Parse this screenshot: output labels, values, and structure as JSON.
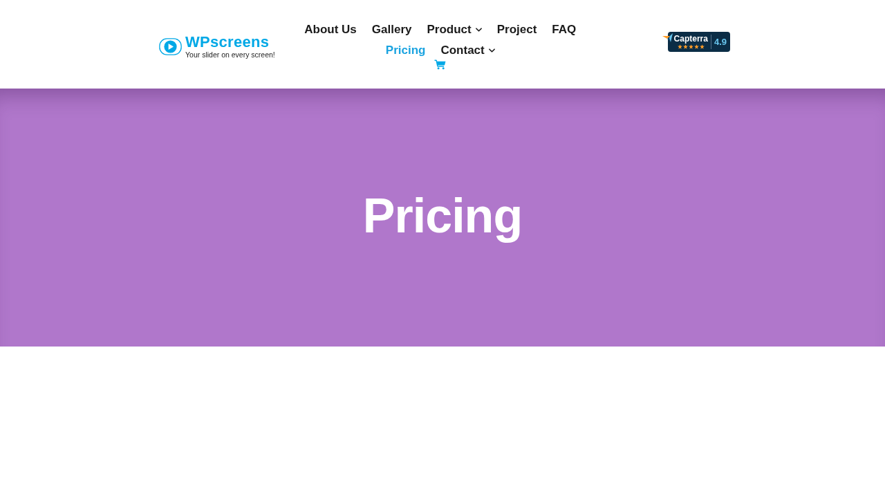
{
  "header": {
    "logo": {
      "name": "WPscreens",
      "tagline": "Your slider on every screen!"
    },
    "nav": [
      {
        "label": "About Us",
        "selected": false,
        "dropdown": false
      },
      {
        "label": "Gallery",
        "selected": false,
        "dropdown": false
      },
      {
        "label": "Product",
        "selected": false,
        "dropdown": true
      },
      {
        "label": "Project",
        "selected": false,
        "dropdown": false
      },
      {
        "label": "FAQ",
        "selected": false,
        "dropdown": false
      },
      {
        "label": "Pricing",
        "selected": true,
        "dropdown": false
      },
      {
        "label": "Contact",
        "selected": false,
        "dropdown": true
      }
    ],
    "rating_badge": {
      "brand": "Capterra",
      "stars": 5,
      "score": "4.9"
    }
  },
  "hero": {
    "title": "Pricing"
  }
}
